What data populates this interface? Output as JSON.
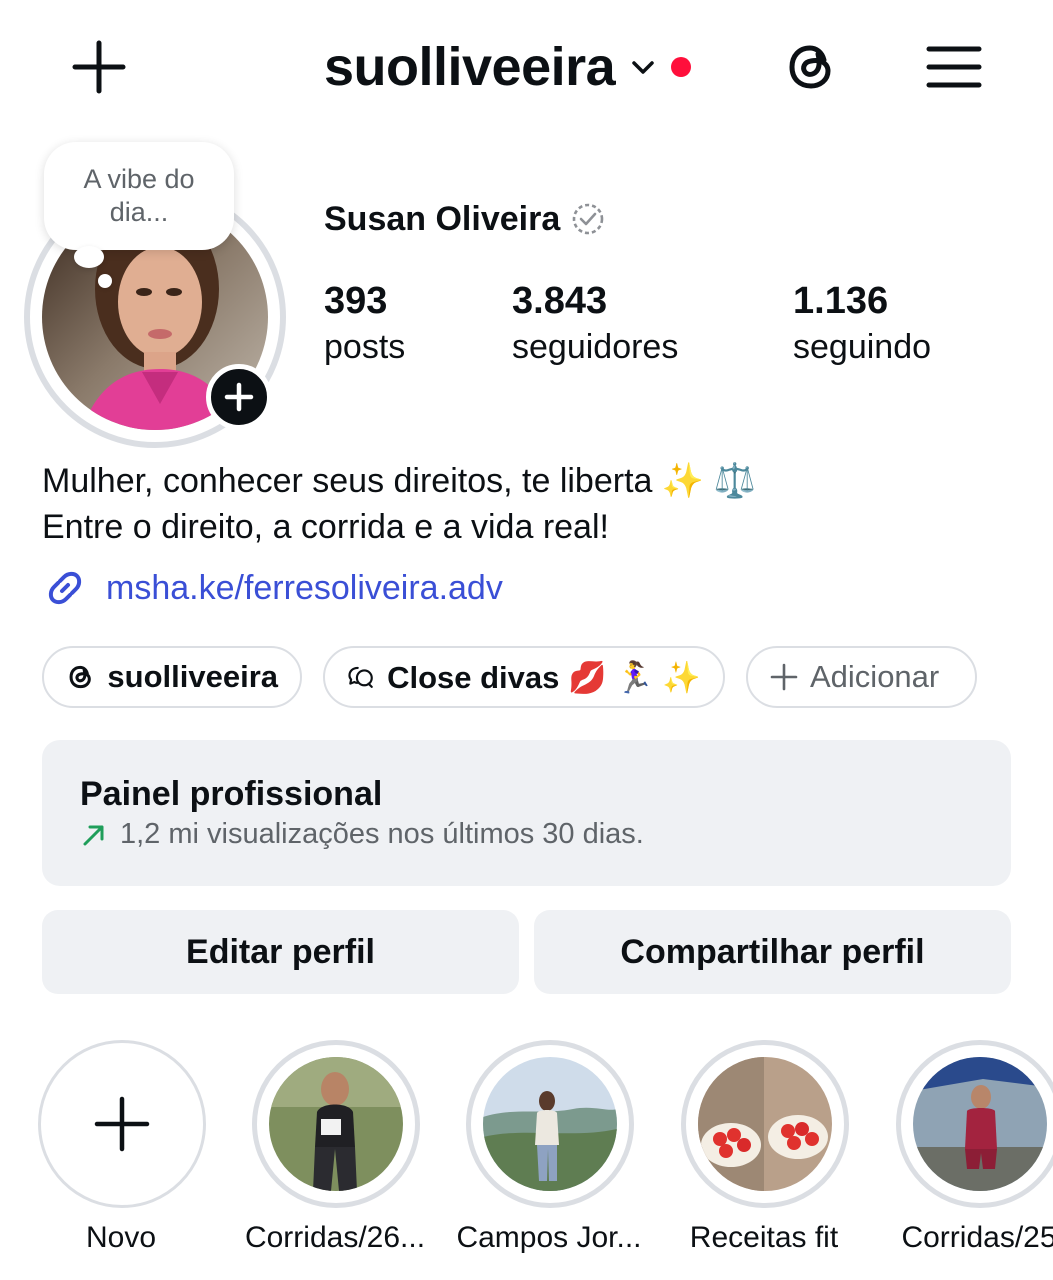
{
  "header": {
    "username": "suolliveeira"
  },
  "profile": {
    "note": "A vibe do dia...",
    "full_name": "Susan Oliveira",
    "stats": {
      "posts": {
        "value": "393",
        "label": "posts"
      },
      "followers": {
        "value": "3.843",
        "label": "seguidores"
      },
      "following": {
        "value": "1.136",
        "label": "seguindo"
      }
    },
    "bio": {
      "line1": "Mulher, conhecer seus direitos, te liberta ✨ ⚖️",
      "line2": "Entre o direito, a corrida e a vida real!"
    },
    "link": "msha.ke/ferresoliveira.adv"
  },
  "pills": {
    "threads": "suolliveeira",
    "close_friends": "Close divas 💋 🏃‍♀️ ✨",
    "add": "Adicionar"
  },
  "dashboard": {
    "title": "Painel profissional",
    "subtitle": "1,2 mi visualizações nos últimos 30 dias."
  },
  "buttons": {
    "edit": "Editar perfil",
    "share": "Compartilhar perfil"
  },
  "highlights": [
    {
      "label": "Novo"
    },
    {
      "label": "Corridas/26..."
    },
    {
      "label": "Campos Jor..."
    },
    {
      "label": "Receitas fit"
    },
    {
      "label": "Corridas/25"
    }
  ],
  "colors": {
    "link": "#3a4fd6",
    "notification_dot": "#ff0f3b",
    "trend_arrow": "#1f9e5a",
    "panel_bg": "#eff1f4"
  }
}
